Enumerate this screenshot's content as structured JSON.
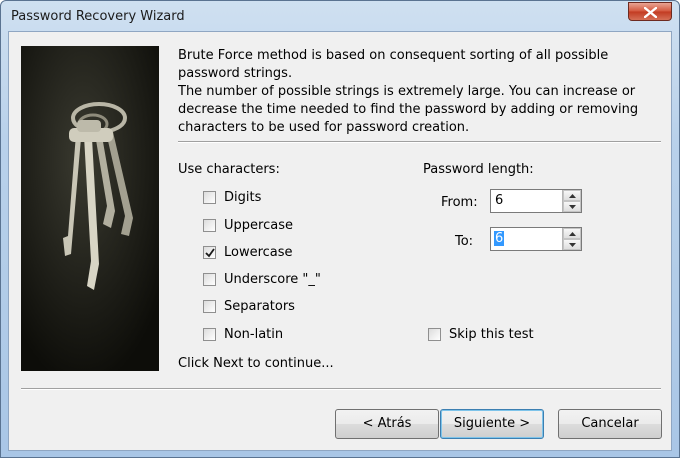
{
  "window": {
    "title": "Password Recovery Wizard"
  },
  "description": {
    "line1": "Brute Force method is based on consequent sorting of all possible password strings.",
    "line2": "The number of possible strings is extremely large. You can increase or decrease the time needed to find the password by adding or removing characters to be used for password creation."
  },
  "characters": {
    "label": "Use characters:",
    "options": [
      {
        "label": "Digits",
        "checked": false
      },
      {
        "label": "Uppercase",
        "checked": false
      },
      {
        "label": "Lowercase",
        "checked": true
      },
      {
        "label": "Underscore \"_\"",
        "checked": false
      },
      {
        "label": "Separators",
        "checked": false
      },
      {
        "label": "Non-latin",
        "checked": false
      }
    ]
  },
  "length": {
    "label": "Password length:",
    "from_label": "From:",
    "from_value": "6",
    "to_label": "To:",
    "to_value": "6"
  },
  "skip": {
    "label": "Skip this test",
    "checked": false
  },
  "hint": "Click Next to continue...",
  "buttons": {
    "back": "< Atrás",
    "next": "Siguiente >",
    "cancel": "Cancelar"
  }
}
